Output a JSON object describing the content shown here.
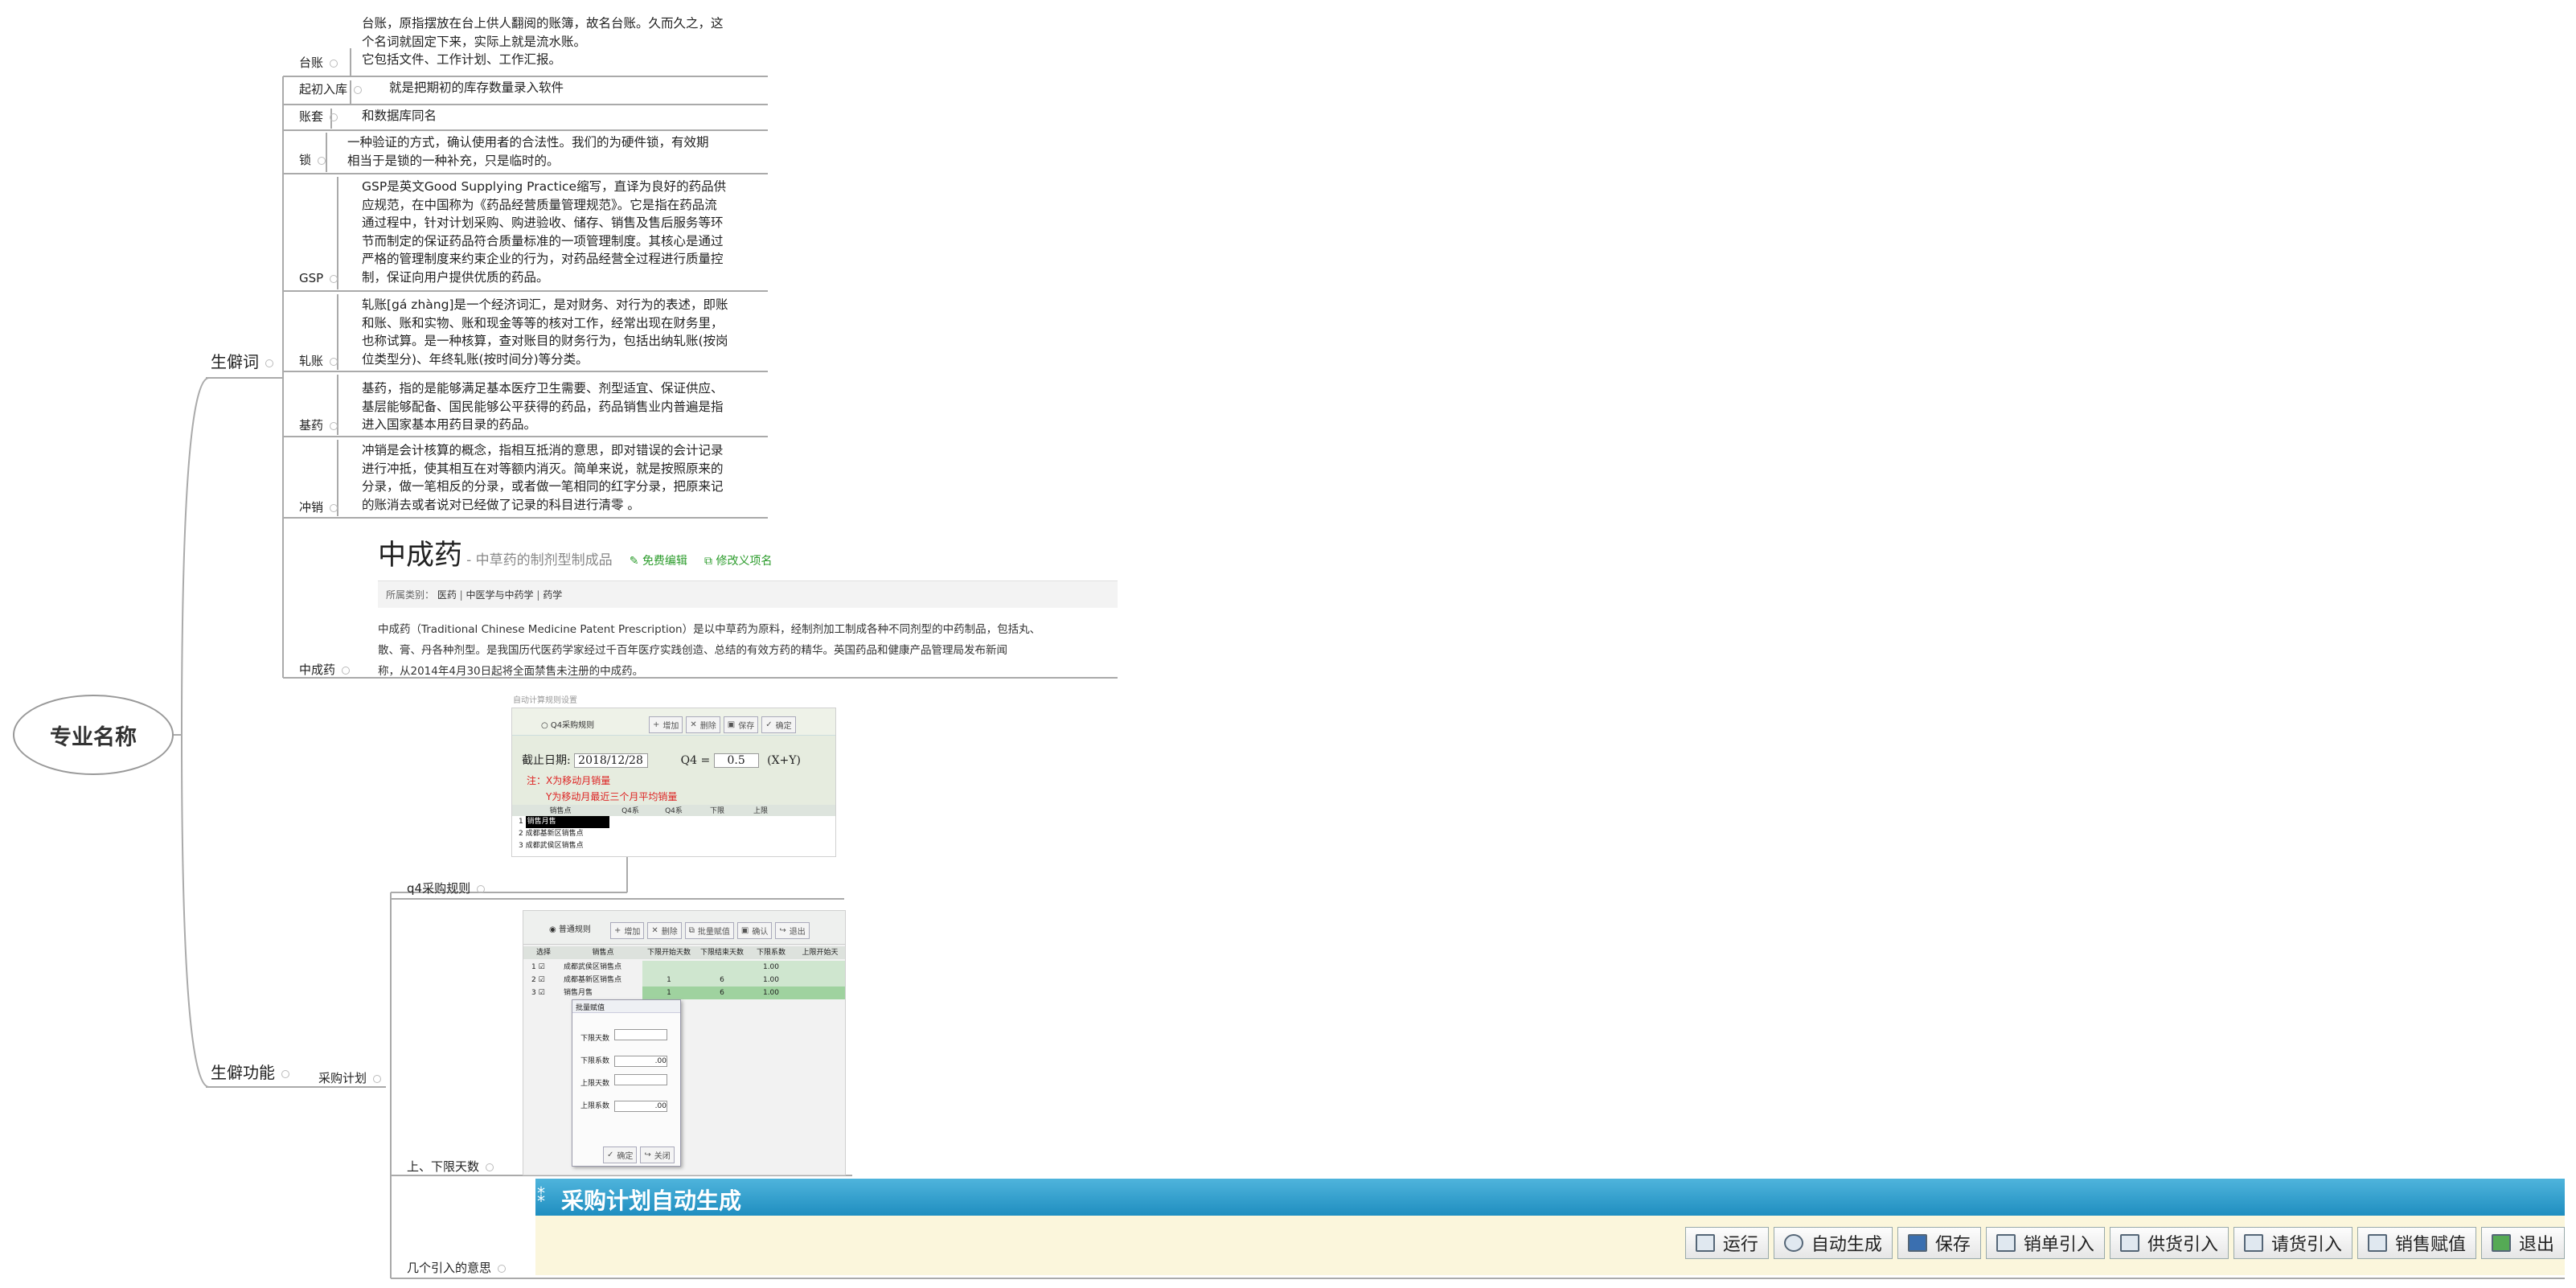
{
  "root": {
    "label": "专业名称"
  },
  "branch_vocab": {
    "label": "生僻词"
  },
  "branch_func": {
    "label": "生僻功能"
  },
  "vocab": [
    {
      "term": "台账",
      "lines": [
        "台账，原指摆放在台上供人翻阅的账簿，故名台账。久而久之，这",
        "个名词就固定下来，实际上就是流水账。",
        "它包括文件、工作计划、工作汇报。"
      ]
    },
    {
      "term": "起初入库",
      "lines": [
        "就是把期初的库存数量录入软件"
      ]
    },
    {
      "term": "账套",
      "lines": [
        "和数据库同名"
      ]
    },
    {
      "term": "锁",
      "lines": [
        "一种验证的方式，确认使用者的合法性。我们的为硬件锁，有效期",
        "相当于是锁的一种补充，只是临时的。"
      ]
    },
    {
      "term": "GSP",
      "lines": [
        "GSP是英文Good Supplying Practice缩写，直译为良好的药品供",
        "应规范，在中国称为《药品经营质量管理规范》。它是指在药品流",
        "通过程中，针对计划采购、购进验收、储存、销售及售后服务等环",
        "节而制定的保证药品符合质量标准的一项管理制度。其核心是通过",
        "严格的管理制度来约束企业的行为，对药品经营全过程进行质量控",
        "制，保证向用户提供优质的药品。"
      ]
    },
    {
      "term": "轧账",
      "lines": [
        "轧账[gá zhàng]是一个经济词汇，是对财务、对行为的表述，即账",
        "和账、账和实物、账和现金等等的核对工作，经常出现在财务里，",
        "也称试算。是一种核算，查对账目的财务行为，包括出纳轧账(按岗",
        "位类型分)、年终轧账(按时间分)等分类。"
      ]
    },
    {
      "term": "基药",
      "lines": [
        "基药，指的是能够满足基本医疗卫生需要、剂型适宜、保证供应、",
        "基层能够配备、国民能够公平获得的药品，药品销售业内普遍是指",
        "进入国家基本用药目录的药品。"
      ]
    },
    {
      "term": "冲销",
      "lines": [
        "冲销是会计核算的概念，指相互抵消的意思，即对错误的会计记录",
        "进行冲抵，使其相互在对等额内消灭。简单来说，就是按照原来的",
        "分录，做一笔相反的分录，或者做一笔相同的红字分录，把原来记",
        "的账消去或者说对已经做了记录的科目进行清零 。"
      ]
    },
    {
      "term": "中成药",
      "lines": []
    }
  ],
  "baike": {
    "title": "中成药",
    "subtitle": "- 中草药的制剂型制成品",
    "edit": "免费编辑",
    "modify": "修改义项名",
    "category_label": "所属类别：",
    "categories": [
      "医药",
      "中医学与中药学",
      "药学"
    ],
    "body1": "中成药（Traditional Chinese Medicine Patent Prescription）是以中草药为原料，经制剂加工制成各种不同剂型的中药制品，包括丸、",
    "body2": "散、膏、丹各种剂型。是我国历代医药学家经过千百年医疗实践创造、总结的有效方药的精华。英国药品和健康产品管理局发布新闻",
    "body3": "称，从2014年4月30日起将全面禁售未注册的中成药。"
  },
  "func": {
    "purchase_plan": "采购计划",
    "children": [
      {
        "label": "q4采购规则"
      },
      {
        "label": "上、下限天数"
      },
      {
        "label": "几个引入的意思"
      }
    ]
  },
  "q4": {
    "caption": "自动计算规则设置",
    "radio": "Q4采购规则",
    "buttons": [
      "增加",
      "删除",
      "保存",
      "确定"
    ],
    "date_label": "截止日期:",
    "date_value": "2018/12/28",
    "q4_label": "Q4 =",
    "q4_value": "0.5",
    "formula": "(X+Y)",
    "note1": "注：X为移动月销量",
    "note2": "Y为移动月最近三个月平均销量",
    "columns": [
      "销售点",
      "Q4系",
      "Q4系",
      "下限",
      "上限"
    ],
    "rows": [
      {
        "n": "1",
        "name": "销售月售"
      },
      {
        "n": "2",
        "name": "成都基新区销售点"
      },
      {
        "n": "3",
        "name": "成都武侯区销售点"
      }
    ]
  },
  "limit": {
    "radio": "普通规则",
    "buttons": [
      "增加",
      "删除",
      "批量赋值",
      "确认",
      "退出"
    ],
    "columns": [
      "选择",
      "销售点",
      "下限开始天数",
      "下限结束天数",
      "下限系数",
      "上限开始天"
    ],
    "rows": [
      {
        "n": "1",
        "name": "成都武侯区销售点",
        "a": "",
        "b": "",
        "c": "1.00"
      },
      {
        "n": "2",
        "name": "成都基新区销售点",
        "a": "1",
        "b": "6",
        "c": "1.00"
      },
      {
        "n": "3",
        "name": "销售月售",
        "a": "1",
        "b": "6",
        "c": "1.00"
      }
    ],
    "dialog": {
      "title": "批量赋值",
      "fields": [
        {
          "label": "下限天数",
          "value": ""
        },
        {
          "label": "下限系数",
          "value": ".00"
        },
        {
          "label": "上限天数",
          "value": ""
        },
        {
          "label": "上限系数",
          "value": ".00"
        }
      ],
      "ok": "确定",
      "close": "关闭"
    }
  },
  "autogen": {
    "title": "采购计划自动生成",
    "buttons": [
      "运行",
      "自动生成",
      "保存",
      "销单引入",
      "供货引入",
      "请货引入",
      "销售赋值",
      "退出"
    ]
  }
}
